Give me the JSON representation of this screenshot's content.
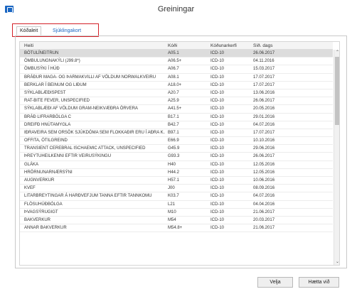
{
  "window": {
    "title": "Greiningar"
  },
  "tabs": [
    {
      "label": "Kóðaleit"
    },
    {
      "label": "Sjúklingakort"
    }
  ],
  "table": {
    "columns": [
      "Heiti",
      "Kóði",
      "Kóðunarkerfi",
      "Síð. dags"
    ],
    "rows": [
      [
        "BÓTULÍNEITRUN",
        "A05.1",
        "ICD-10",
        "26.06.2017"
      ],
      [
        "ÖMBULUNGNAKÝLI (J99.8*)",
        "A06.5+",
        "ICD-10",
        "04.11.2016"
      ],
      [
        "ÖMBUSÝKI Í HÚÐ",
        "A06.7",
        "ICD-10",
        "15.03.2017"
      ],
      [
        "BRÁÐUR MAGA- OG ÞARMAKVILLI AF VÖLDUM NORWALKVEIRU",
        "A08.1",
        "ICD-10",
        "17.07.2017"
      ],
      [
        "BERKLAR Í BEINUM OG LIÐUM",
        "A18.0+",
        "ICD-10",
        "17.07.2017"
      ],
      [
        "SÝKLABLÆÐISPEST",
        "A20.7",
        "ICD-10",
        "13.06.2016"
      ],
      [
        "RAT-BITE FEVER, UNSPECIFIED",
        "A25.9",
        "ICD-10",
        "26.06.2017"
      ],
      [
        "SÝKLABLÆÐI AF VÖLDUM GRAM-NEIKVÆÐRA ÖRVERA",
        "A41.5+",
        "ICD-10",
        "20.05.2016"
      ],
      [
        "BRÁÐ LIFRARBÓLGA C",
        "B17.1",
        "ICD-10",
        "29.01.2016"
      ],
      [
        "DREIFÐ HNÚTAMYGLA",
        "B42.7",
        "ICD-10",
        "04.07.2016"
      ],
      [
        "IÐRAVEIRA SEM ORSÖK SJÚKDÓMA SEM FLOKKAÐIR ERU Í AÐRA K...",
        "B97.1",
        "ICD-10",
        "17.07.2017"
      ],
      [
        "OFFITA, ÓTILGREIND",
        "E66.9",
        "ICD-10",
        "10.10.2016"
      ],
      [
        "TRANSIENT CEREBRAL ISCHAEMIC ATTACK, UNSPECIFIED",
        "G45.9",
        "ICD-10",
        "29.06.2016"
      ],
      [
        "ÞREYTUHEILKENNI EFTIR VEIRUSÝKINGU",
        "G93.3",
        "ICD-10",
        "26.06.2017"
      ],
      [
        "GLÁKA",
        "H40",
        "ICD-10",
        "12.05.2016"
      ],
      [
        "HRÖRNUNARNÆRSÝNI",
        "H44.2",
        "ICD-10",
        "12.05.2016"
      ],
      [
        "AUGNVERKUR",
        "H57.1",
        "ICD-10",
        "10.06.2016"
      ],
      [
        "KVEF",
        "J00",
        "ICD-10",
        "08.09.2016"
      ],
      [
        "LITARBREYTINGAR Á HARÐVEFJUM TANNA EFTIR TANNKOMU",
        "K03.7",
        "ICD-10",
        "04.07.2016"
      ],
      [
        "FLÖSUHÚÐBÓLGA",
        "L21",
        "ICD-10",
        "04.04.2016"
      ],
      [
        "ÞVAGSÝRUGIGT",
        "M10",
        "ICD-10",
        "21.06.2017"
      ],
      [
        "BAKVERKUR",
        "M54",
        "ICD-10",
        "20.03.2017"
      ],
      [
        "ANNAR BAKVERKUR",
        "M54.8+",
        "ICD-10",
        "21.06.2017"
      ]
    ]
  },
  "buttons": {
    "select": "Velja",
    "cancel": "Hætta við"
  }
}
